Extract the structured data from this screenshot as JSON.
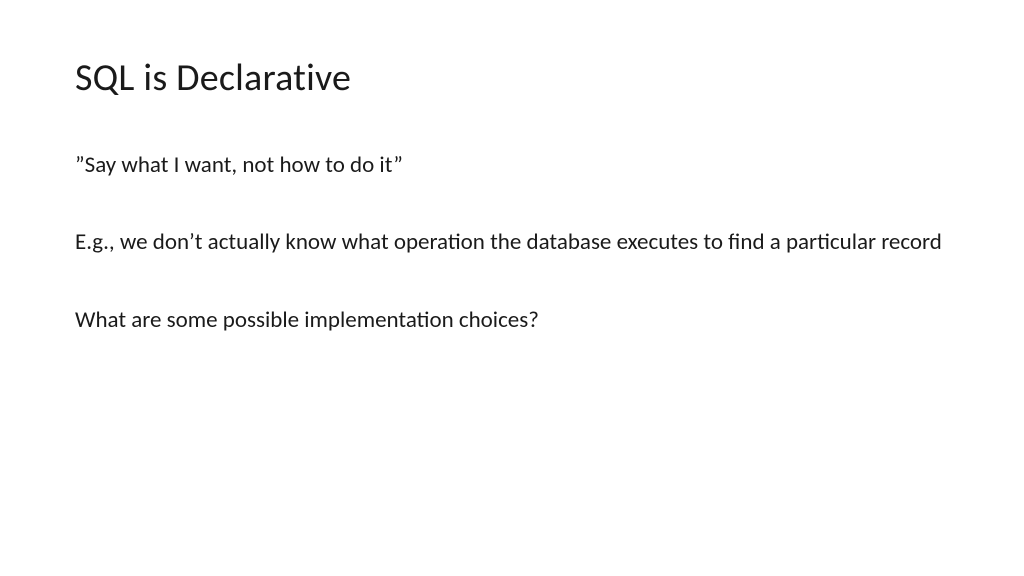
{
  "slide": {
    "title": "SQL is Declarative",
    "paragraphs": [
      "”Say what I want, not how to do it”",
      "E.g., we don’t actually know what operation the database executes to find a particular record",
      "What are some possible implementation choices?"
    ]
  }
}
